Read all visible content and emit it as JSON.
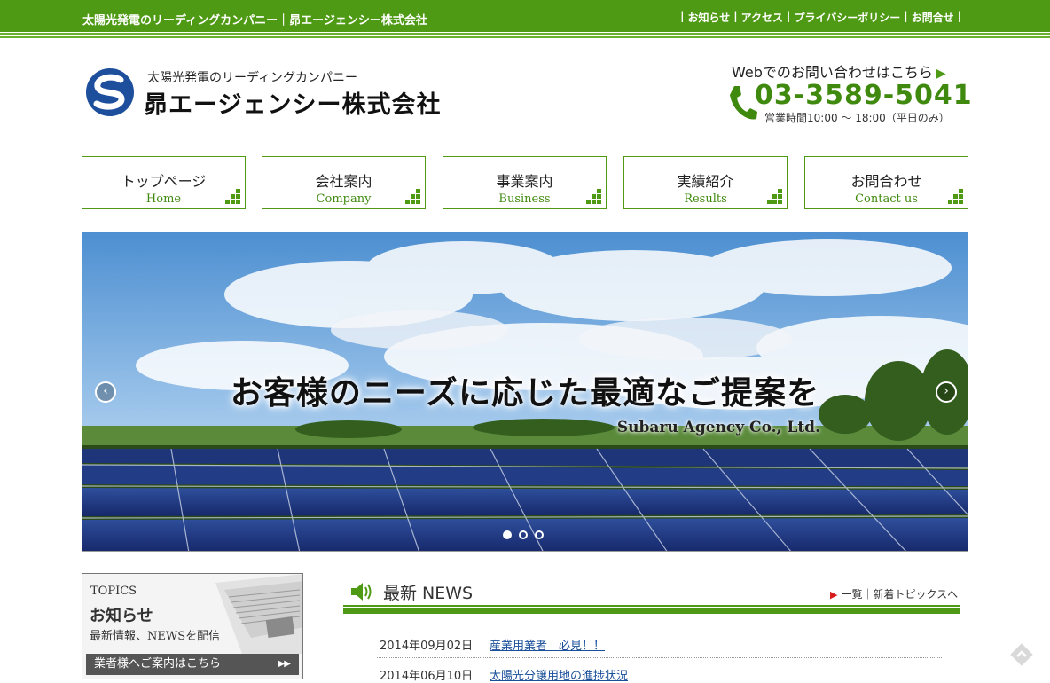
{
  "topbar": {
    "tagline": "太陽光発電のリーディングカンパニー｜昴エージェンシー株式会社",
    "links": [
      "お知らせ",
      "アクセス",
      "プライバシーポリシー",
      "お問合せ"
    ]
  },
  "header": {
    "logo_sub": "太陽光発電のリーディングカンパニー",
    "logo_name": "昴エージェンシー株式会社",
    "contact_label": "Webでのお問い合わせはこちら",
    "phone": "03-3589-5041",
    "hours": "営業時間10:00 ～ 18:00（平日のみ）"
  },
  "nav": [
    {
      "ja": "トップページ",
      "en": "Home"
    },
    {
      "ja": "会社案内",
      "en": "Company"
    },
    {
      "ja": "事業案内",
      "en": "Business"
    },
    {
      "ja": "実績紹介",
      "en": "Results"
    },
    {
      "ja": "お問合わせ",
      "en": "Contact us"
    }
  ],
  "hero": {
    "headline": "お客様のニーズに応じた最適なご提案を",
    "sub": "Subaru Agency Co., Ltd.",
    "active_slide": 1,
    "slide_count": 3
  },
  "topics": {
    "en": "TOPICS",
    "title": "お知らせ",
    "desc": "最新情報、NEWSを配信",
    "bar": "業者様へご案内はこちら",
    "bar_arrow": "▶▶"
  },
  "news": {
    "title": "最新 NEWS",
    "more": "一覧｜新着トピックスへ",
    "items": [
      {
        "date": "2014年09月02日",
        "title": "産業用業者　必見！！"
      },
      {
        "date": "2014年06月10日",
        "title": "太陽光分譲用地の進捗状況"
      }
    ]
  },
  "colors": {
    "brand_green": "#4f9a14",
    "phone_green": "#3f8a0e",
    "link_blue": "#1a4f9a"
  },
  "icons": {
    "phone": "phone-icon",
    "speaker": "speaker-icon",
    "nav_dots": "green-dots-icon",
    "scroll_top": "scroll-top-icon"
  }
}
